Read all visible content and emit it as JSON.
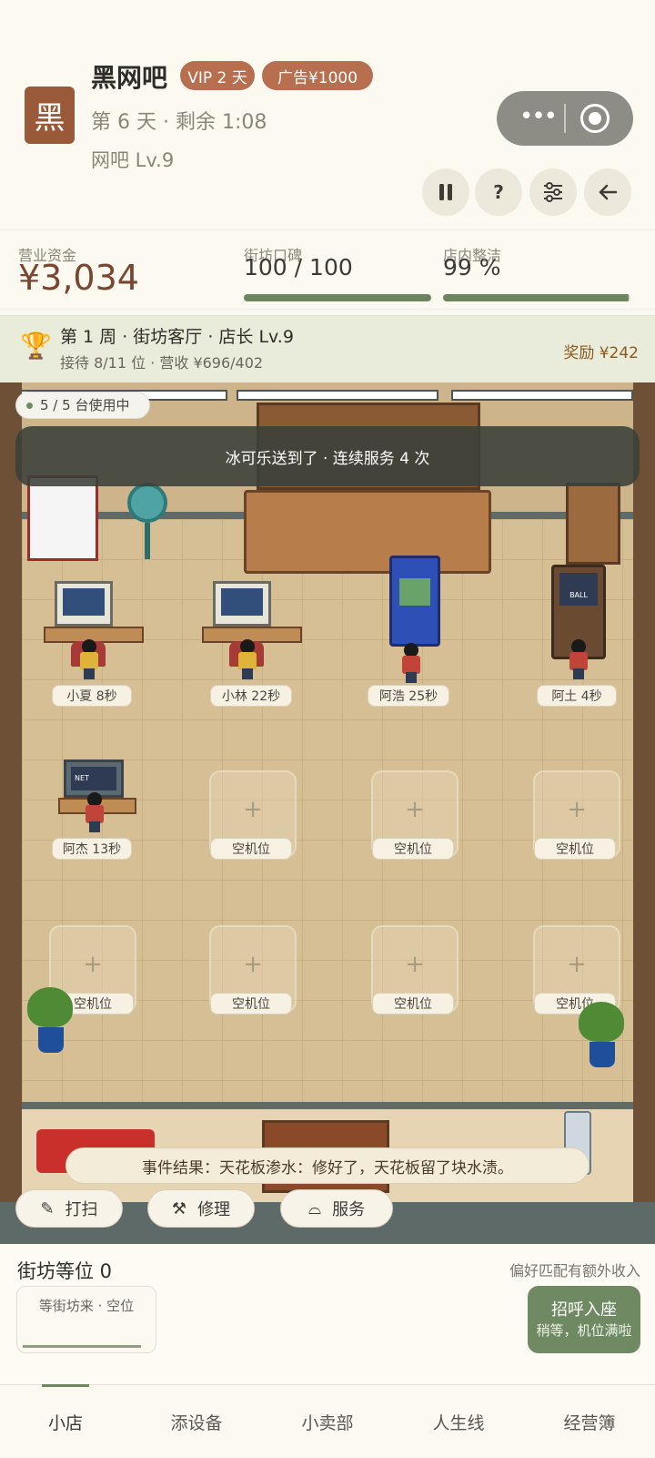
{
  "header": {
    "app_icon_char": "黑",
    "shop_name": "黑网吧",
    "vip_badge": "VIP 2 天",
    "ad_badge": "广告¥1000",
    "day_line": "第 6 天 · 剩余 1:08",
    "level_line": "网吧 Lv.9"
  },
  "controls": {
    "pause_icon": "pause-icon",
    "help_label": "?",
    "settings_icon": "sliders-icon",
    "back_icon": "arrow-left-icon"
  },
  "stats": {
    "funds_label": "营业资金",
    "funds_value": "¥3,034",
    "reputation_label": "街坊口碑",
    "reputation_value": "100 / 100",
    "reputation_fraction": 1.0,
    "cleanliness_label": "店内整洁",
    "cleanliness_value": "99 %",
    "cleanliness_fraction": 0.99
  },
  "weekly": {
    "title": "第 1 周 · 街坊客厅 · 店长 Lv.9",
    "subtitle": "接待 8/11 位 · 营收 ¥696/402",
    "reward": "奖励 ¥242"
  },
  "scene": {
    "usage_badge": "5 / 5 台使用中",
    "toast": "冰可乐送到了 · 连续服务 4 次",
    "occupied_seats": [
      {
        "tag": "小夏 8秒",
        "device": "computer"
      },
      {
        "tag": "小林 22秒",
        "device": "computer"
      },
      {
        "tag": "阿浩 25秒",
        "device": "arcade"
      },
      {
        "tag": "阿土 4秒",
        "device": "pinball"
      },
      {
        "tag": "阿杰 13秒",
        "device": "tv"
      }
    ],
    "empty_slot_label": "空机位",
    "empty_slot_count": 7,
    "tv_screen_text": "NET",
    "pinball_screen_text": "BALL",
    "event_result": "事件结果：天花板渗水：修好了，天花板留了块水渍。",
    "actions": [
      {
        "label": "打扫",
        "icon": "broom-icon"
      },
      {
        "label": "修理",
        "icon": "wrench-icon"
      },
      {
        "label": "服务",
        "icon": "serving-tray-icon"
      }
    ]
  },
  "queue": {
    "title": "街坊等位 0",
    "hint": "偏好匹配有额外收入",
    "card_label": "等街坊来 · 空位",
    "greet_title": "招呼入座",
    "greet_sub": "稍等，机位满啦"
  },
  "tabs": [
    "小店",
    "添设备",
    "小卖部",
    "人生线",
    "经营簿"
  ],
  "active_tab": "小店",
  "colors": {
    "accent_green": "#6d8460",
    "badge_brown": "#b86f4f",
    "funds_brown": "#7a4630"
  }
}
